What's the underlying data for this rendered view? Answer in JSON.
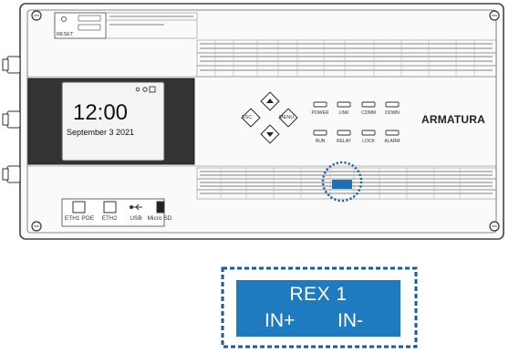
{
  "device": {
    "screen": {
      "time": "12:00",
      "date": "September 3 2021"
    },
    "brand": "ARMATURA",
    "keypad": {
      "esc": "ESC",
      "menu": "MENU"
    },
    "leds": [
      "POWER",
      "LINK",
      "COMM",
      "DOWN",
      "RUN",
      "RELAY",
      "LOCK",
      "ALARM"
    ],
    "ports": [
      "ETH1 POE",
      "ETH2",
      "USB",
      "Micro SD"
    ],
    "reset_label": "RESET",
    "highlight_color": "#1f6fb8"
  },
  "zoom": {
    "line1": "REX 1",
    "in_plus": "IN+",
    "in_minus": "IN-",
    "box_color": "#1f7bbf",
    "border_color": "#1a5aa0"
  }
}
